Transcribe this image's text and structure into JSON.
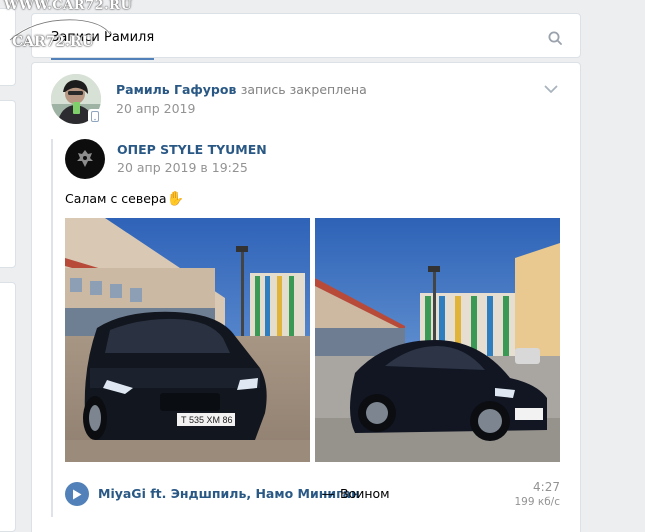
{
  "watermark": {
    "line1": "WWW.CAR72.RU",
    "line2": "CAR72.RU"
  },
  "wall": {
    "tab_title": "Записи Рамиля",
    "search_icon": "search-icon"
  },
  "post": {
    "author": "Рамиль Гафуров",
    "action": "запись закреплена",
    "date": "20 апр 2019",
    "menu_icon": "chevron-down-icon",
    "repost": {
      "group_name": "ОПЕР STYLE TYUMEN",
      "date": "20 апр 2019 в 19:25",
      "text": "Салам с севера",
      "emoji": "✋",
      "photos": [
        "car-front-photo",
        "car-side-photo"
      ],
      "audio": {
        "artist": "MiyaGi ft. Эндшпиль, Намо Миниган",
        "dash": "—",
        "title": "Воином",
        "duration": "4:27",
        "bitrate": "199 кб/с"
      }
    }
  },
  "colors": {
    "link": "#2a5885",
    "accent": "#5181b8",
    "meta": "#939393",
    "background": "#edeef0"
  }
}
